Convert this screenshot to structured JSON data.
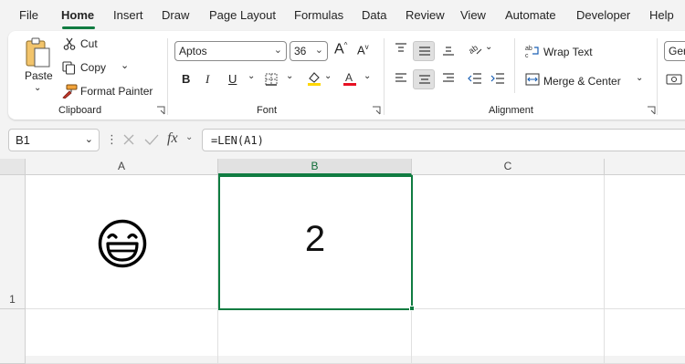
{
  "menu": {
    "tabs": [
      "File",
      "Home",
      "Insert",
      "Draw",
      "Page Layout",
      "Formulas",
      "Data",
      "Review",
      "View",
      "Automate",
      "Developer",
      "Help"
    ],
    "active_tab": "Home"
  },
  "ribbon": {
    "clipboard": {
      "paste_label": "Paste",
      "cut_label": "Cut",
      "copy_label": "Copy",
      "format_painter_label": "Format Painter",
      "group_label": "Clipboard"
    },
    "font": {
      "font_name": "Aptos",
      "font_size": "36",
      "bold_label": "B",
      "italic_label": "I",
      "underline_label": "U",
      "group_label": "Font"
    },
    "alignment": {
      "wrap_text_label": "Wrap Text",
      "merge_center_label": "Merge & Center",
      "group_label": "Alignment"
    },
    "number": {
      "format_partial": "Gen"
    }
  },
  "formula_bar": {
    "name_box": "B1",
    "fx_label": "fx",
    "formula": "=LEN(A1)"
  },
  "grid": {
    "columns": [
      "A",
      "B",
      "C"
    ],
    "rows": [
      "1"
    ],
    "cells": {
      "A1": "😄",
      "B1": "2"
    },
    "selected_cell": "B1"
  },
  "colors": {
    "accent": "#107c41",
    "highlight_yellow": "#ffd700",
    "font_red": "#e81123"
  }
}
